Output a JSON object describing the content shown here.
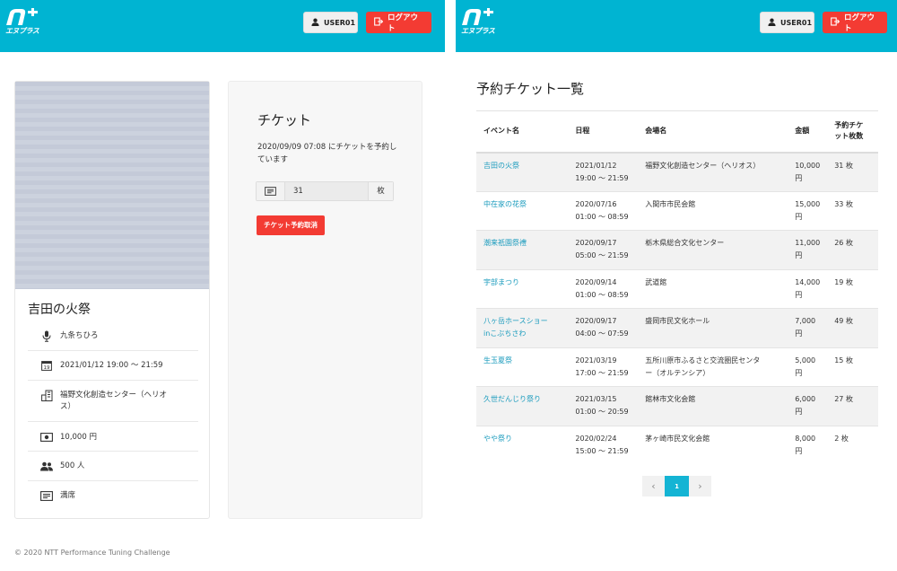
{
  "header": {
    "logo_text": "エヌプラス",
    "user_label": "USER01",
    "logout_label": "ログアウト",
    "brand_color": "#00b4d2",
    "logout_color": "#f33b33"
  },
  "event": {
    "title": "吉田の火祭",
    "performer": "九条ちひろ",
    "datetime": "2021/01/12 19:00 〜 21:59",
    "venue_line1": "福野文化創造センター（ヘリオ",
    "venue_line2": "ス）",
    "price": "10,000 円",
    "capacity": "500 人",
    "status": "満席"
  },
  "ticket": {
    "heading": "チケット",
    "status_line1": "2020/09/09 07:08 にチケットを予約し",
    "status_line2": "ています",
    "count_value": "31",
    "count_unit": "枚",
    "cancel_label": "チケット予約取消"
  },
  "footer": {
    "copyright": "© 2020 NTT Performance Tuning Challenge"
  },
  "list": {
    "title": "予約チケット一覧",
    "columns": {
      "name": "イベント名",
      "date": "日程",
      "venue": "会場名",
      "price": "金額",
      "count_line1": "予約チケ",
      "count_line2": "ット枚数"
    },
    "rows": [
      {
        "name_l1": "吉田の火祭",
        "name_l2": "",
        "date": "2021/01/12",
        "time": "19:00 〜 21:59",
        "venue_l1": "福野文化創造センター（ヘリオス）",
        "venue_l2": "",
        "price_l1": "10,000",
        "price_l2": "円",
        "count": "31 枚"
      },
      {
        "name_l1": "中在家の花祭",
        "name_l2": "",
        "date": "2020/07/16",
        "time": "01:00 〜 08:59",
        "venue_l1": "入間市市民会館",
        "venue_l2": "",
        "price_l1": "15,000",
        "price_l2": "円",
        "count": "33 枚"
      },
      {
        "name_l1": "潮来祇園祭禮",
        "name_l2": "",
        "date": "2020/09/17",
        "time": "05:00 〜 21:59",
        "venue_l1": "栃木県総合文化センター",
        "venue_l2": "",
        "price_l1": "11,000",
        "price_l2": "円",
        "count": "26 枚"
      },
      {
        "name_l1": "宇部まつり",
        "name_l2": "",
        "date": "2020/09/14",
        "time": "01:00 〜 08:59",
        "venue_l1": "武道館",
        "venue_l2": "",
        "price_l1": "14,000",
        "price_l2": "円",
        "count": "19 枚"
      },
      {
        "name_l1": "八ヶ岳ホースショー",
        "name_l2": "inこぶちさわ",
        "date": "2020/09/17",
        "time": "04:00 〜 07:59",
        "venue_l1": "盛岡市民文化ホール",
        "venue_l2": "",
        "price_l1": "7,000",
        "price_l2": "円",
        "count": "49 枚"
      },
      {
        "name_l1": "生玉夏祭",
        "name_l2": "",
        "date": "2021/03/19",
        "time": "17:00 〜 21:59",
        "venue_l1": "五所川原市ふるさと交流圏民センタ",
        "venue_l2": "ー（オルテンシア）",
        "price_l1": "5,000",
        "price_l2": "円",
        "count": "15 枚"
      },
      {
        "name_l1": "久世だんじり祭り",
        "name_l2": "",
        "date": "2021/03/15",
        "time": "01:00 〜 20:59",
        "venue_l1": "館林市文化会館",
        "venue_l2": "",
        "price_l1": "6,000",
        "price_l2": "円",
        "count": "27 枚"
      },
      {
        "name_l1": "やや祭り",
        "name_l2": "",
        "date": "2020/02/24",
        "time": "15:00 〜 21:59",
        "venue_l1": "茅ヶ崎市民文化会館",
        "venue_l2": "",
        "price_l1": "8,000",
        "price_l2": "円",
        "count": "2 枚"
      }
    ],
    "pagination": {
      "prev": "‹",
      "current": "1",
      "next": "›"
    }
  }
}
